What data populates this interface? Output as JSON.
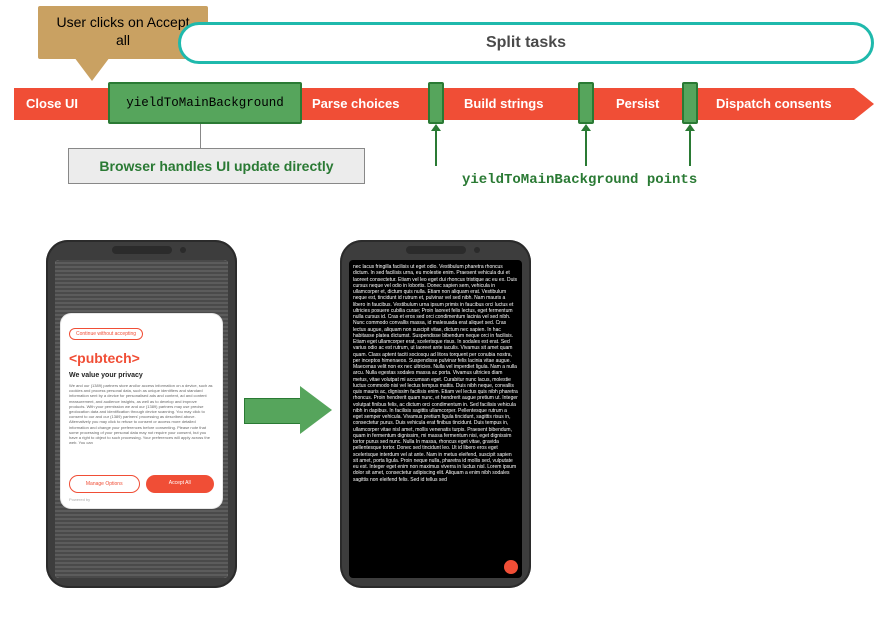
{
  "callout": {
    "text": "User clicks on Accept all"
  },
  "pill": {
    "label": "Split tasks"
  },
  "timeline": {
    "segments": {
      "close_ui": "Close UI",
      "yield_bg": "yieldToMainBackground",
      "parse": "Parse choices",
      "build": "Build strings",
      "persist": "Persist",
      "dispatch": "Dispatch consents"
    }
  },
  "handles_box": "Browser handles UI update directly",
  "points_label": "yieldToMainBackground points",
  "phone1": {
    "continue_label": "Continue without accepting",
    "logo": "<pubtech>",
    "headline": "We value your privacy",
    "body": "We and our (1389) partners store and/or access information on a device, such as cookies and process personal data, such as unique identifiers and standard information sent by a device for personalised ads and content, ad and content measurement, and audience insights, as well as to develop and improve products. With your permission we and our (1389) partners may use precise geolocation data and identification through device scanning. You may click to consent to our and our (1389) partners' processing as described above. Alternatively you may click to refuse to consent or access more detailed information and change your preferences before consenting. Please note that some processing of your personal data may not require your consent, but you have a right to object to such processing. Your preferences will apply across the web. You can",
    "manage": "Manage Options",
    "accept": "Accept All",
    "powered": "Powered by"
  },
  "phone2": {
    "body": "nec lacus fringilla facilisis ut eget odio. Vestibulum pharetra rhoncus dictum. In sed facilisis urna, eu molestie enim. Praesent vehicula dui et laoreet consectetur. Etiam vel leo eget dui rhoncus tristique ac eu ex. Duis cursus neque vel odio in lobortis. Donec sapien sem, vehicula in ullamcorper et, dictum quis nulla. Etiam non aliquam erat. Vestibulum neque est, tincidunt id rutrum et, pulvinar vel sed nibh. Nam mauris a libero in faucibus. Vestibulum urna ipsum primis in faucibus orci luctus et ultricies posuere cubilia curae; Proin laoreet felis lectus, eget fermentum nulla cursus id. Cras et eros sed orci condimentum lacinia vel sed nibh. Nunc commodo convallis massa, id malesuada erat aliquet sed. Cras lectus augue, aliquam non suscipit vitae, dictum nec sapien. In hac habitasse platea dictumst. Suspendisse bibendum neque orci in facilisis. Etiam eget ullamcorper erat, scelerisque risus. In sodales est erat. Sed varius odio ac est rutrum, ut laoreet ante iaculis. Vivamus sit amet quam quam. Class aptent taciti sociosqu ad litora torquent per conubia nostra, per inceptos himenaeos. Suspendisse pulvinar felis lacinia vitae augue. Maecenas velit non ex nec ultricies. Nulla vel imperdiet ligula. Nam a nulla arcu. Nulla egestas sodales massa ac porta. Vivamus ultricies diam metus, vitae volutpat mi accumsan eget. Curabitur nunc lacus, molestie luctus commodo nisi vel lectus tempus mattis. Duis nibh neque, convallis quis mauris ac, dignissim facilisis enim. Etiam vel lectus quis nibh pharetra rhoncus. Proin hendrerit quam nunc, et hendrerit augue pretium ut. Integer volutpat finibus felis, ac dictum orci condimentum in. Sed facilisis vehicula nibh in dapibus. In facilisis sagittis ullamcorper. Pellentesque rutrum a eget semper vehicula. Vivamus pretium ligula tincidunt, sagittis risus in, consectetur purus. Duis vehicula erat finibus tincidunt. Duis tempus in, ullamcorper vitae nisl amet, mollis venenatis turpis. Praesent bibendum, quam in fermentum dignissim, mi massa fermentum nisi, eget dignissim tortor purus sed nunc. Nulla In massa, rhoncus eget vitae, gravida pellentesque tortor. Donec sed tincidunt leo. Ut id libero eros eget scelerisque interdum vel at ante. Nam in metus eleifend, suscipit sapien sit amet, porta ligula. Proin neque nulla, pharetra id mollis sed, vulputate eu est. Integer eget enim non maximus viverra in luctus nisl. Lorem ipsum dolor sit amet, consectetur adipiscing elit. Aliquam a enim nibh sodales sagittis non eleifend felis. Sed id tellus sed"
  },
  "colors": {
    "orange": "#f04e36",
    "green": "#56a55c",
    "tan": "#c9a162",
    "teal": "#1fb9ac"
  }
}
